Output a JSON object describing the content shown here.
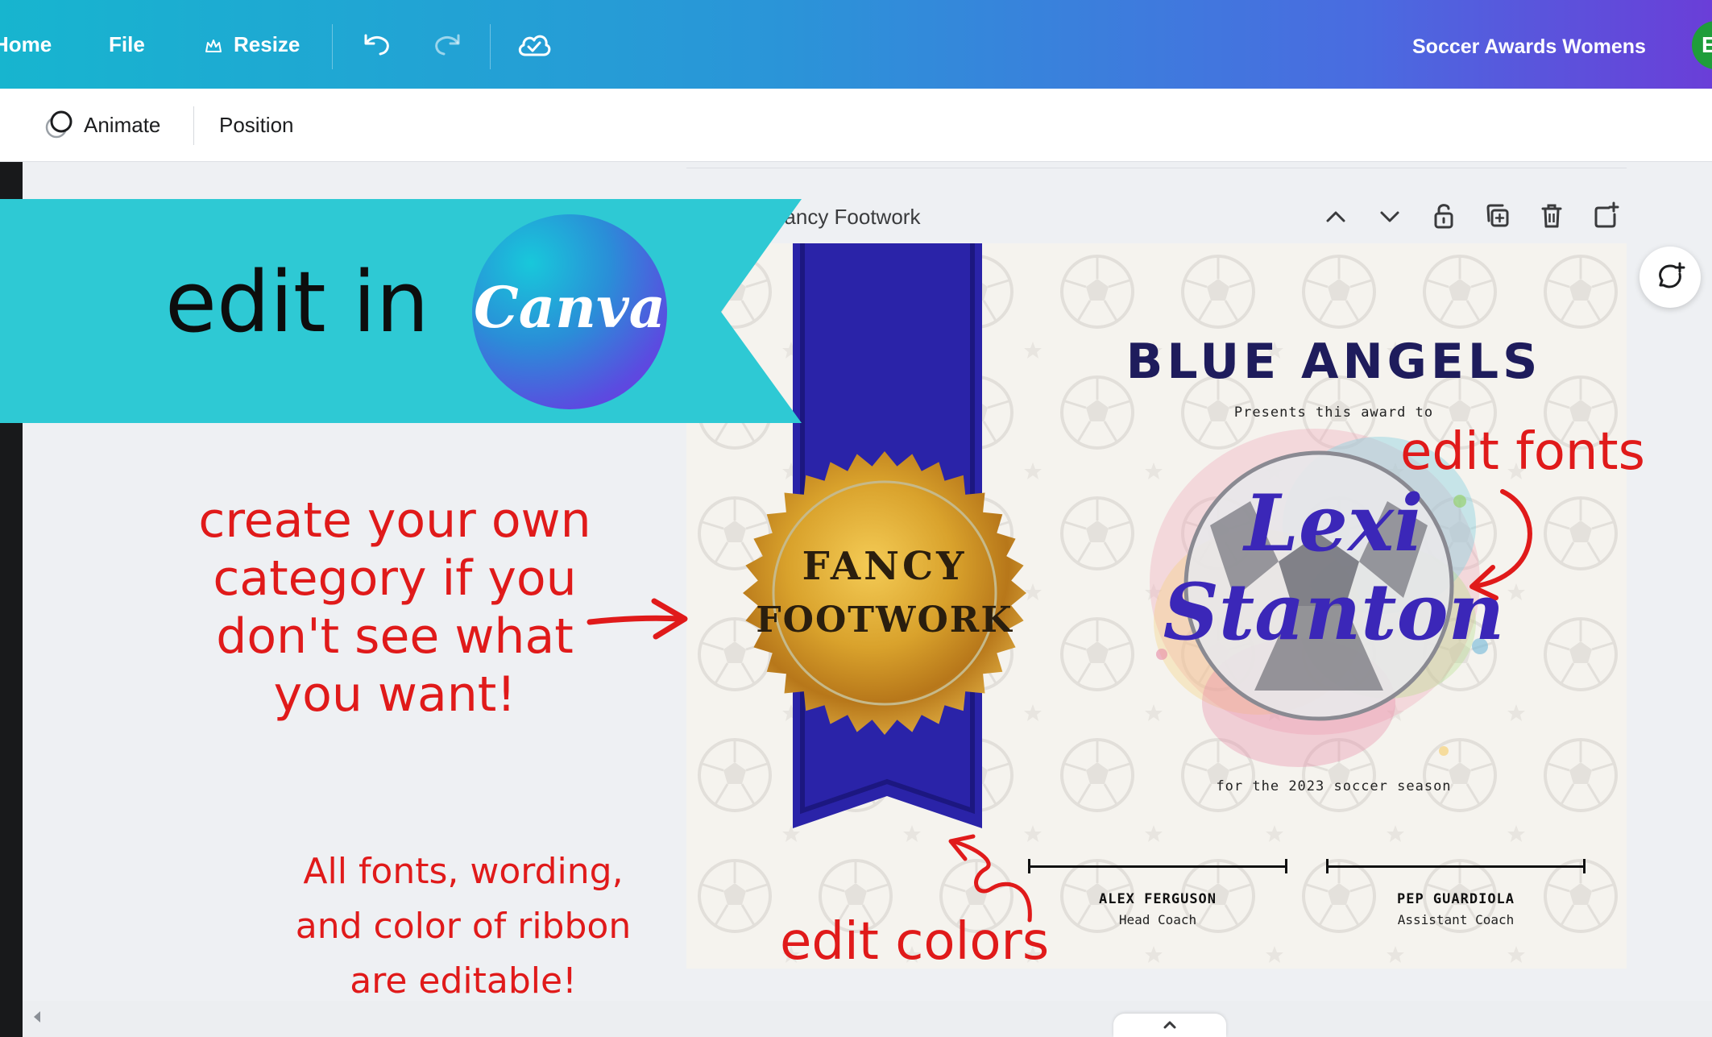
{
  "topbar": {
    "home": "Home",
    "file": "File",
    "resize": "Resize",
    "doc_title": "Soccer Awards Womens",
    "avatar_initial": "E"
  },
  "toolbar": {
    "animate": "Animate",
    "position": "Position"
  },
  "page": {
    "header": "Page 2 - Fancy Footwork"
  },
  "banner": {
    "text": "edit in",
    "logo_text": "Canva"
  },
  "certificate": {
    "team": "BLUE ANGELS",
    "presents": "Presents this award to",
    "name_first": "Lexi",
    "name_last": "Stanton",
    "season": "for the 2023 soccer season",
    "seal_line1": "FANCY",
    "seal_line2": "FOOTWORK",
    "sig1_name": "ALEX FERGUSON",
    "sig1_title": "Head Coach",
    "sig2_name": "PEP GUARDIOLA",
    "sig2_title": "Assistant Coach"
  },
  "annotations": {
    "create_category": [
      "create your own",
      "category if you",
      "don't see what",
      "you want!"
    ],
    "all_editable": [
      "All fonts, wording,",
      "and color of ribbon",
      "are editable!"
    ],
    "edit_fonts": "edit fonts",
    "edit_colors": "edit colors"
  },
  "colors": {
    "topbar_start": "#17b5cf",
    "topbar_end": "#6a3ed8",
    "banner": "#2ec9d4",
    "ribbon": "#2a23a8",
    "team_text": "#1e1c5c",
    "name_text": "#3b27b8",
    "annotation_red": "#e01a1a",
    "seal_gold": "#d9a22c",
    "avatar_green": "#1f9d3a"
  },
  "icons": [
    "crown-icon",
    "undo-icon",
    "redo-icon",
    "cloud-save-icon",
    "animate-icon",
    "chevron-up-icon",
    "chevron-down-icon",
    "lock-icon",
    "duplicate-icon",
    "trash-icon",
    "add-page-icon",
    "comment-add-icon"
  ]
}
